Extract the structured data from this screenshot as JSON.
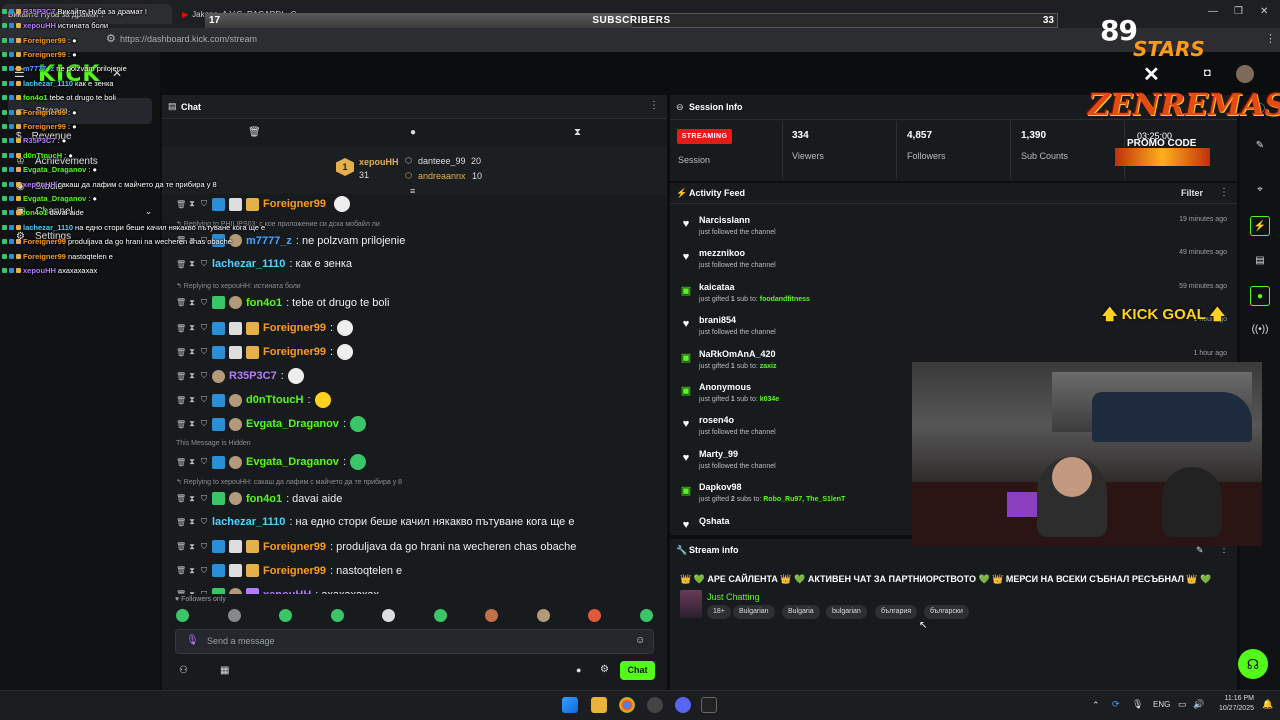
{
  "browser": {
    "tabs": [
      "Викайте Нуба за драмат !",
      "Jakone, A.V.G, RAGARDI - С..."
    ],
    "url": "https://dashboard.kick.com/stream"
  },
  "subscribers_bar": {
    "label": "SUBSCRIBERS",
    "current": "17",
    "goal": "33",
    "progress": 0.5
  },
  "overlay_chat": [
    {
      "user": "R35P3C7",
      "text": "Викайте Нуба за драмат !",
      "color": "#b57cff"
    },
    {
      "user": "xepouHH",
      "text": "истината боли",
      "color": "#b57cff"
    },
    {
      "user": "Foreigner99",
      "text": "",
      "color": "#ff9a1a"
    },
    {
      "user": "Foreigner99",
      "text": "",
      "color": "#ff9a1a"
    },
    {
      "user": "m7777_z",
      "text": "ne polzvam prilojenie",
      "color": "#4aa3ff"
    },
    {
      "user": "lachezar_1110",
      "text": "как е зенка",
      "color": "#53d1ff"
    },
    {
      "user": "fon4o1",
      "text": "tebe ot drugo te boli",
      "color": "#53fc18"
    },
    {
      "user": "Foreigner99",
      "text": "",
      "color": "#ff9a1a"
    },
    {
      "user": "Foreigner99",
      "text": "",
      "color": "#ff9a1a"
    },
    {
      "user": "R35P3C7",
      "text": "",
      "color": "#b57cff"
    },
    {
      "user": "d0nTtoucH",
      "text": "",
      "color": "#53fc18"
    },
    {
      "user": "Evgata_Draganov",
      "text": "",
      "color": "#53fc18"
    },
    {
      "user": "xepouHH",
      "text": "сакаш да лафим с майчето да те прибира у 8",
      "color": "#b57cff"
    },
    {
      "user": "Evgata_Draganov",
      "text": "",
      "color": "#53fc18"
    },
    {
      "user": "fon4o1",
      "text": "davai aide",
      "color": "#53fc18"
    },
    {
      "user": "lachezar_1110",
      "text": "на едно стори беше качил някакво пътуване кога ще е",
      "color": "#53d1ff"
    },
    {
      "user": "Foreigner99",
      "text": "produljava da go hrani na wecheren chas obache",
      "color": "#ff9a1a"
    },
    {
      "user": "Foreigner99",
      "text": "nastoqtelen e",
      "color": "#ff9a1a"
    },
    {
      "user": "xepouHH",
      "text": "ахахахахах",
      "color": "#b57cff"
    }
  ],
  "sidebar": {
    "logo": "KICK",
    "items": [
      {
        "label": "Stream",
        "icon": "stream-icon"
      },
      {
        "label": "Revenue",
        "icon": "revenue-icon"
      },
      {
        "label": "Achievements",
        "icon": "trophy-icon"
      },
      {
        "label": "Studio",
        "icon": "studio-icon"
      },
      {
        "label": "Channel",
        "icon": "channel-icon"
      },
      {
        "label": "Settings",
        "icon": "gear-icon"
      }
    ]
  },
  "chat": {
    "title": "Chat",
    "pinned": {
      "rank1_user": "xepouHH",
      "rank1_value": "31",
      "rank2_user": "danteee_99",
      "rank2_value": "20",
      "rank3_user": "andreaannx",
      "rank3_value": "10"
    },
    "messages": [
      {
        "type": "msg",
        "user": "Foreigner99",
        "text": "",
        "color": "#ff9a1a",
        "badges": [
          "blue",
          "white",
          "gift"
        ]
      },
      {
        "type": "reply",
        "text": "Replying to PHILIPS03: с кое приложение си дска мобайл ли"
      },
      {
        "type": "msg",
        "user": "m7777_z",
        "text": ": ne polzvam prilojenie",
        "color": "#4aa3ff",
        "badges": [
          "blue",
          "face"
        ]
      },
      {
        "type": "msg",
        "user": "lachezar_1110",
        "text": ": как е зенка",
        "color": "#53d1ff",
        "badges": []
      },
      {
        "type": "reply",
        "text": "Replying to xepouHH: истината боли"
      },
      {
        "type": "msg",
        "user": "fon4o1",
        "text": ": tebe ot drugo te boli",
        "color": "#53fc18",
        "badges": [
          "green",
          "face"
        ]
      },
      {
        "type": "msg",
        "user": "Foreigner99",
        "text": ":",
        "color": "#ff9a1a",
        "badges": [
          "blue",
          "white",
          "gift"
        ]
      },
      {
        "type": "msg",
        "user": "Foreigner99",
        "text": ":",
        "color": "#ff9a1a",
        "badges": [
          "blue",
          "white",
          "gift"
        ]
      },
      {
        "type": "msg",
        "user": "R35P3C7",
        "text": ":",
        "color": "#b57cff",
        "badges": [
          "face"
        ]
      },
      {
        "type": "msg",
        "user": "d0nTtoucH",
        "text": ":",
        "color": "#53fc18",
        "badges": [
          "blue",
          "face"
        ]
      },
      {
        "type": "msg",
        "user": "Evgata_Draganov",
        "text": ":",
        "color": "#53fc18",
        "badges": [
          "blue",
          "face"
        ]
      },
      {
        "type": "hidden",
        "text": "This Message is Hidden"
      },
      {
        "type": "msg",
        "user": "Evgata_Draganov",
        "text": ":",
        "color": "#53fc18",
        "badges": [
          "blue",
          "face"
        ]
      },
      {
        "type": "reply",
        "text": "Replying to xepouHH: сакаш да лафим с майчето да те прибира у 8"
      },
      {
        "type": "msg",
        "user": "fon4o1",
        "text": ": davai aide",
        "color": "#53fc18",
        "badges": [
          "green",
          "face"
        ]
      },
      {
        "type": "msg",
        "user": "lachezar_1110",
        "text": ": на едно стори беше качил някакво пътуване кога ще е",
        "color": "#53d1ff",
        "badges": []
      },
      {
        "type": "msg",
        "user": "Foreigner99",
        "text": ": produljava da go hrani na wecheren chas obache",
        "color": "#ff9a1a",
        "badges": [
          "blue",
          "white",
          "gift"
        ]
      },
      {
        "type": "msg",
        "user": "Foreigner99",
        "text": ": nastoqtelen e",
        "color": "#ff9a1a",
        "badges": [
          "blue",
          "white",
          "gift"
        ]
      },
      {
        "type": "msg",
        "user": "xepouHH",
        "text": ": ахахахахах",
        "color": "#b57cff",
        "badges": [
          "green",
          "face",
          "purple"
        ]
      }
    ],
    "followers_only": "Followers only",
    "input_placeholder": "Send a message",
    "send_label": "Chat"
  },
  "session": {
    "title": "Session Info",
    "status": "STREAMING",
    "status_label": "Session",
    "viewers": "334",
    "viewers_label": "Viewers",
    "followers": "4,857",
    "followers_label": "Followers",
    "subs": "1,390",
    "subs_label": "Sub Counts"
  },
  "activity": {
    "title": "Activity Feed",
    "filter": "Filter",
    "items": [
      {
        "user": "Narcisslann",
        "kind": "follow",
        "desc": "just followed the channel",
        "time": "19 minutes ago"
      },
      {
        "user": "mezznikoo",
        "kind": "follow",
        "desc": "just followed the channel",
        "time": "49 minutes ago"
      },
      {
        "user": "kaicataa",
        "kind": "gift",
        "desc_pre": "just gifted ",
        "count": "1",
        "desc_mid": " sub to: ",
        "target": "foodandfitness",
        "time": "59 minutes ago"
      },
      {
        "user": "brani854",
        "kind": "follow",
        "desc": "just followed the channel",
        "time": "1 hour ago"
      },
      {
        "user": "NaRkOmAnA_420",
        "kind": "gift",
        "desc_pre": "just gifted ",
        "count": "1",
        "desc_mid": " sub to: ",
        "target": "zaxiz",
        "time": "1 hour ago"
      },
      {
        "user": "Anonymous",
        "kind": "gift",
        "desc_pre": "just gifted ",
        "count": "1",
        "desc_mid": " sub to: ",
        "target": "k034e",
        "time": ""
      },
      {
        "user": "rosen4o",
        "kind": "follow",
        "desc": "just followed the channel",
        "time": ""
      },
      {
        "user": "Marty_99",
        "kind": "follow",
        "desc": "just followed the channel",
        "time": ""
      },
      {
        "user": "Dapkov98",
        "kind": "gift",
        "desc_pre": "just gifted ",
        "count": "2",
        "desc_mid": " subs to: ",
        "target": "Robo_Ru97, The_S1lenT",
        "time": ""
      },
      {
        "user": "Qshata",
        "kind": "follow",
        "desc": "",
        "time": ""
      }
    ]
  },
  "stream_info": {
    "title": "Stream info",
    "stream_title": "👑 💚 АРЕ САЙЛЕНТА 👑 💚 АКТИВЕН ЧАТ ЗА ПАРТНИОРСТВОТО 💚 👑 МЕРСИ НА ВСЕКИ СЪБНАЛ РЕСЪБНАЛ 👑 💚",
    "category": "Just Chatting",
    "tags": [
      "18+",
      "Bulgarian",
      "Bulgaria",
      "bulgarian",
      "българия",
      "български"
    ]
  },
  "overlay": {
    "logo_num": "89",
    "logo_word": "STARS",
    "brand": "ZENREMASTA",
    "promo_time": "03:25:00",
    "promo_label": "PROMO CODE",
    "kick_goal": "KICK GOAL"
  },
  "taskbar": {
    "lang": "ENG",
    "time": "11:16 PM",
    "date": "10/27/2025"
  },
  "colors": {
    "kick_green": "#53fc18",
    "streaming_red": "#e91916",
    "panel": "#181b1d"
  }
}
